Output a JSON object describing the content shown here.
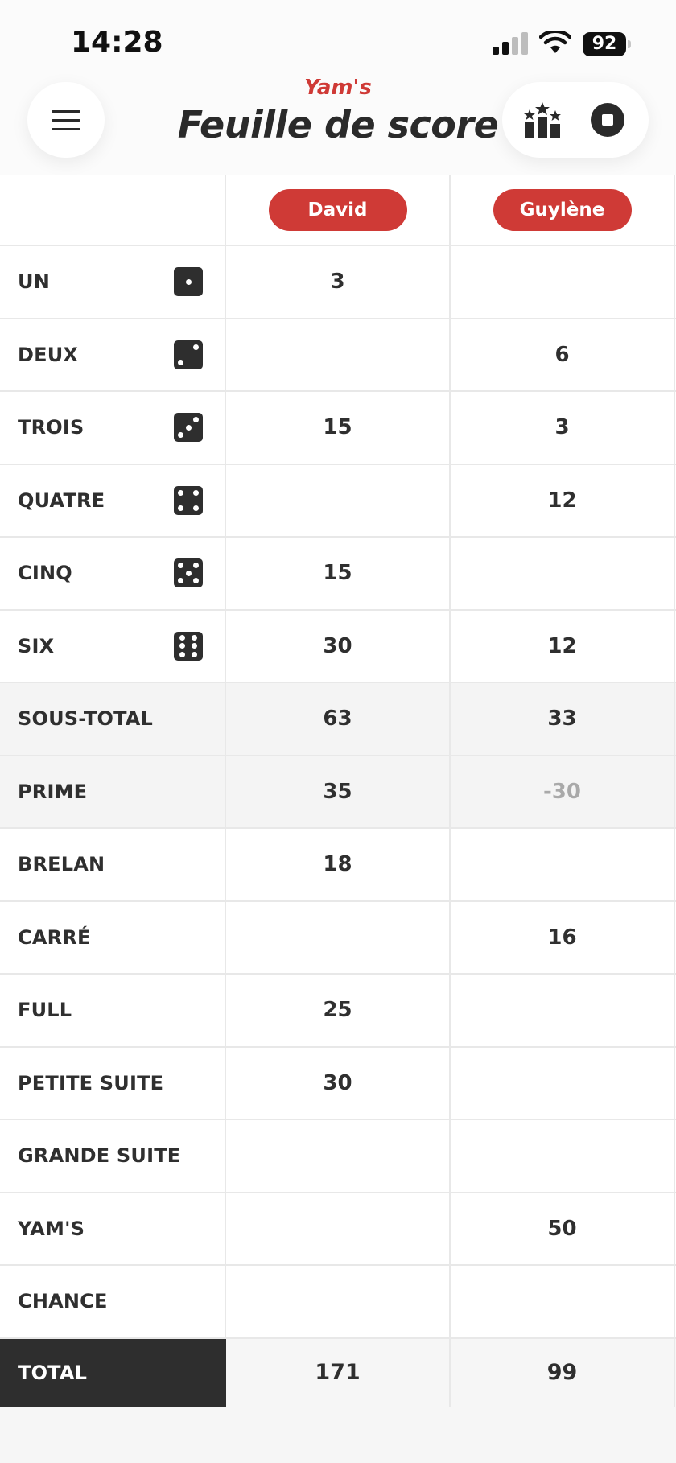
{
  "status_bar": {
    "time": "14:28",
    "battery": "92"
  },
  "header": {
    "subtitle": "Yam's",
    "title": "Feuille de score"
  },
  "players": [
    "David",
    "Guylène"
  ],
  "rows": [
    {
      "label": "UN",
      "die": 1,
      "scores": [
        "3",
        ""
      ]
    },
    {
      "label": "DEUX",
      "die": 2,
      "scores": [
        "",
        "6"
      ]
    },
    {
      "label": "TROIS",
      "die": 3,
      "scores": [
        "15",
        "3"
      ]
    },
    {
      "label": "QUATRE",
      "die": 4,
      "scores": [
        "",
        "12"
      ]
    },
    {
      "label": "CINQ",
      "die": 5,
      "scores": [
        "15",
        ""
      ]
    },
    {
      "label": "SIX",
      "die": 6,
      "scores": [
        "30",
        "12"
      ]
    },
    {
      "label": "SOUS-TOTAL",
      "shaded": true,
      "scores": [
        "63",
        "33"
      ]
    },
    {
      "label": "PRIME",
      "shaded": true,
      "scores": [
        "35",
        "-30"
      ]
    },
    {
      "label": "BRELAN",
      "scores": [
        "18",
        ""
      ]
    },
    {
      "label": "CARRÉ",
      "scores": [
        "",
        "16"
      ]
    },
    {
      "label": "FULL",
      "scores": [
        "25",
        ""
      ]
    },
    {
      "label": "PETITE SUITE",
      "scores": [
        "30",
        ""
      ]
    },
    {
      "label": "GRANDE SUITE",
      "scores": [
        "",
        ""
      ]
    },
    {
      "label": "YAM'S",
      "scores": [
        "",
        "50"
      ]
    },
    {
      "label": "CHANCE",
      "scores": [
        "",
        ""
      ]
    }
  ],
  "total": {
    "label": "TOTAL",
    "scores": [
      "171",
      "99"
    ]
  },
  "icons": {
    "menu": "hamburger-menu-icon",
    "ranking": "podium-stars-icon",
    "stop": "stop-icon",
    "signal": "cellular-signal-icon",
    "wifi": "wifi-icon",
    "battery": "battery-icon"
  },
  "colors": {
    "accent": "#cf3a36",
    "dark": "#2e2e2e",
    "muted": "#a9a9a9"
  }
}
